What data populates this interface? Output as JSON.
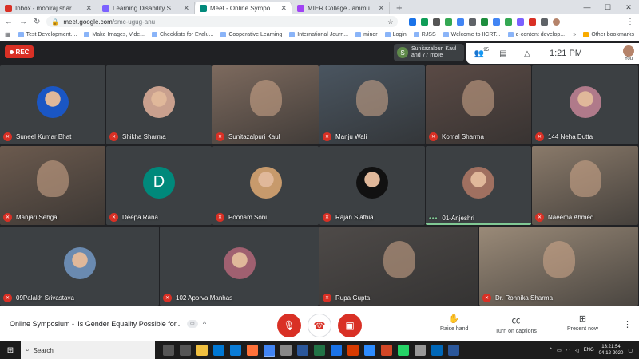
{
  "browser": {
    "tabs": [
      {
        "title": "Inbox - moolraj.sharma@miercol...",
        "color": "#d93025",
        "active": false
      },
      {
        "title": "Learning Disability Scale (सीखने",
        "color": "#7b61ff",
        "active": false
      },
      {
        "title": "Meet - Online Symposium -",
        "color": "#00897b",
        "active": true
      },
      {
        "title": "MIER College Jammu",
        "color": "#a142f4",
        "active": false
      }
    ],
    "new_tab": "+",
    "window_controls": [
      "—",
      "☐",
      "✕"
    ],
    "url_host": "meet.google.com",
    "url_path": "/smc-ugug-anu",
    "bookmarks": [
      "Test Development....",
      "Make Images, Vide...",
      "Checklists for Evalu...",
      "Cooperative Learning",
      "International Journ...",
      "minor",
      "Login",
      "RJSS",
      "Welcome to IICRT...",
      "e-content develop..."
    ],
    "other_bookmarks": "Other bookmarks"
  },
  "meet": {
    "rec_label": "REC",
    "speaker": {
      "initial": "S",
      "name": "Sunitazalpuri Kaul",
      "more": "and 77 more"
    },
    "top_controls": {
      "people_count": "95",
      "time": "1:21 PM",
      "you_label": "You"
    },
    "participants": [
      {
        "name": "Suneel Kumar Bhat",
        "type": "avatar",
        "color": "#1a56c4"
      },
      {
        "name": "Shikha Sharma",
        "type": "avatar",
        "color": "#c9a08e"
      },
      {
        "name": "Sunitazalpuri Kaul",
        "type": "video",
        "color": "#7d6a5e"
      },
      {
        "name": "Manju Wali",
        "type": "video",
        "color": "#4a5560"
      },
      {
        "name": "Komal Sharma",
        "type": "video",
        "color": "#5a4a45"
      },
      {
        "name": "144 Neha Dutta",
        "type": "avatar",
        "color": "#b07a8a"
      },
      {
        "name": "Manjari Sehgal",
        "type": "video",
        "color": "#6b5a4e"
      },
      {
        "name": "Deepa Rana",
        "type": "letter",
        "letter": "D",
        "color": "#00897b"
      },
      {
        "name": "Poonam Soni",
        "type": "avatar",
        "color": "#c79a6c"
      },
      {
        "name": "Rajan Slathia",
        "type": "avatar",
        "color": "#111111"
      },
      {
        "name": "01-Anjeshri",
        "type": "avatar",
        "color": "#a07060",
        "speaking": true
      },
      {
        "name": "Naeema Ahmed",
        "type": "video",
        "color": "#8a7a6a"
      },
      {
        "name": "09Palakh Srivastava",
        "type": "avatar",
        "color": "#6a8ab0"
      },
      {
        "name": "102 Aporva Manhas",
        "type": "avatar",
        "color": "#a06070"
      },
      {
        "name": "Rupa Gupta",
        "type": "video",
        "color": "#4e4a48"
      },
      {
        "name": "Dr. Rohnika Sharma",
        "type": "video",
        "color": "#9a8a78"
      }
    ],
    "bottom": {
      "meeting_title": "Online Symposium - 'Is Gender Equality Possible for...",
      "raise_hand": "Raise hand",
      "captions": "Turn on captions",
      "present": "Present now"
    }
  },
  "taskbar": {
    "search_placeholder": "Search",
    "lang": "ENG",
    "time": "13:21:54",
    "date": "04-12-2020",
    "apps": [
      "#555555",
      "#555555",
      "#f0c040",
      "#0078d4",
      "#0a7cd6",
      "#ff7139",
      "#4285f4",
      "#888888",
      "#2b579a",
      "#217346",
      "#1a73e8",
      "#d83b01",
      "#2d8cff",
      "#d24726",
      "#25d366",
      "#999999",
      "#0067b8",
      "#2b579a"
    ]
  }
}
